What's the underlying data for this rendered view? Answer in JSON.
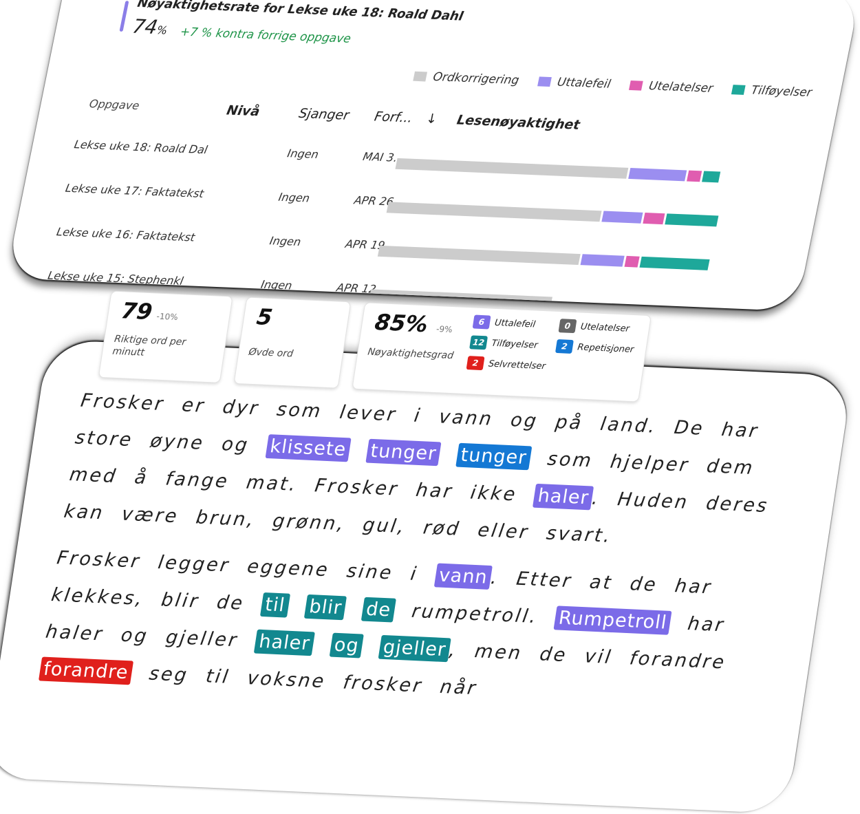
{
  "header": {
    "title": "Nøyaktighetsrate for Lekse uke 18: Roald Dahl",
    "value": "74",
    "value_unit": "%",
    "delta": "+7 % kontra forrige oppgave"
  },
  "legend": [
    {
      "label": "Ordkorrigering",
      "color": "#cccccc"
    },
    {
      "label": "Uttalefeil",
      "color": "#9b8ef0"
    },
    {
      "label": "Utelatelser",
      "color": "#e05db0"
    },
    {
      "label": "Tilføyelser",
      "color": "#1ea89a"
    }
  ],
  "table": {
    "columns": [
      "Oppgave",
      "Nivå",
      "Sjanger",
      "Forf...",
      "↓",
      "Lesenøyaktighet"
    ],
    "rows": [
      {
        "task": "Lekse uke 18: Roald Dal",
        "genre": "Ingen",
        "date": "MAI 3.",
        "segments": [
          0.7,
          0.17,
          0.04,
          0.05
        ]
      },
      {
        "task": "Lekse uke 17: Faktatekst",
        "genre": "Ingen",
        "date": "APR 26.",
        "segments": [
          0.66,
          0.12,
          0.06,
          0.16
        ]
      },
      {
        "task": "Lekse uke 16: Faktatekst",
        "genre": "Ingen",
        "date": "APR 19.",
        "segments": [
          0.62,
          0.13,
          0.04,
          0.21
        ]
      },
      {
        "task": "Lekse uke 15: Stephenkl",
        "genre": "Ingen",
        "date": "APR 12.",
        "segments": [
          0.55,
          0.0,
          0.0,
          0.0
        ]
      }
    ]
  },
  "stats": {
    "wpm": {
      "value": "79",
      "delta": "-10%",
      "label": "Riktige ord per minutt"
    },
    "practiced": {
      "value": "5",
      "label": "Øvde ord"
    },
    "accuracy": {
      "value": "85%",
      "delta": "-9%",
      "label": "Nøyaktighetsgrad"
    },
    "badges": [
      {
        "count": "6",
        "label": "Uttalefeil",
        "color": "#7b6be8"
      },
      {
        "count": "0",
        "label": "Utelatelser",
        "color": "#666666"
      },
      {
        "count": "12",
        "label": "Tilføyelser",
        "color": "#12888f"
      },
      {
        "count": "2",
        "label": "Repetisjoner",
        "color": "#1478d4"
      },
      {
        "count": "2",
        "label": "Selvrettelser",
        "color": "#e0201c"
      }
    ]
  },
  "passage": {
    "p1": [
      {
        "t": "Frosker er dyr som lever i vann og på land. De har store øyne og "
      },
      {
        "t": "klissete",
        "c": "purple"
      },
      {
        "t": " "
      },
      {
        "t": "tunger",
        "c": "purple"
      },
      {
        "t": " "
      },
      {
        "t": "tunger",
        "c": "blue"
      },
      {
        "t": " som hjelper dem med å fange mat. Frosker har ikke "
      },
      {
        "t": "haler",
        "c": "purple"
      },
      {
        "t": ". Huden deres kan være brun, grønn, gul, rød eller svart."
      }
    ],
    "p2": [
      {
        "t": "Frosker legger eggene sine i "
      },
      {
        "t": "vann",
        "c": "purple"
      },
      {
        "t": ". Etter at de har klekkes, blir de "
      },
      {
        "t": "til",
        "c": "teal"
      },
      {
        "t": " "
      },
      {
        "t": "blir",
        "c": "teal"
      },
      {
        "t": " "
      },
      {
        "t": "de",
        "c": "teal"
      },
      {
        "t": " rumpetroll. "
      },
      {
        "t": "Rumpetroll",
        "c": "purple"
      },
      {
        "t": " har haler og gjeller "
      },
      {
        "t": "haler",
        "c": "teal"
      },
      {
        "t": " "
      },
      {
        "t": "og",
        "c": "teal"
      },
      {
        "t": " "
      },
      {
        "t": "gjeller",
        "c": "teal"
      },
      {
        "t": ", men de vil forandre "
      },
      {
        "t": "forandre",
        "c": "red"
      },
      {
        "t": " seg til voksne frosker når"
      }
    ]
  }
}
